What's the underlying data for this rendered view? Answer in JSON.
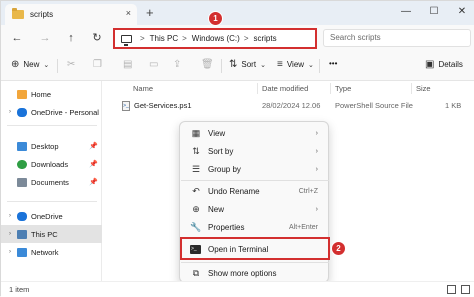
{
  "tab": {
    "title": "scripts",
    "close": "×"
  },
  "new_tab": "+",
  "window_controls": {
    "minimize": "—",
    "maximize": "☐",
    "close": "✕"
  },
  "nav": {
    "back": "←",
    "forward": "→",
    "up": "↑",
    "refresh": "↻"
  },
  "address": {
    "crumbs": [
      "This PC",
      "Windows (C:)",
      "scripts"
    ],
    "separator": ">"
  },
  "search": {
    "placeholder": "Search scripts"
  },
  "callouts": {
    "one": "1",
    "two": "2"
  },
  "commands": {
    "new": "New",
    "sort": "Sort",
    "view": "View",
    "more": "•••",
    "details": "Details"
  },
  "sidebar": {
    "home": "Home",
    "onedrive_personal": "OneDrive - Personal",
    "desktop": "Desktop",
    "downloads": "Downloads",
    "documents": "Documents",
    "onedrive": "OneDrive",
    "this_pc": "This PC",
    "network": "Network"
  },
  "columns": {
    "name": "Name",
    "date": "Date modified",
    "type": "Type",
    "size": "Size"
  },
  "file": {
    "name": "Get-Services.ps1",
    "date": "28/02/2024 12.06",
    "type": "PowerShell Source File",
    "size": "1 KB"
  },
  "context_menu": {
    "view": "View",
    "sort_by": "Sort by",
    "group_by": "Group by",
    "undo_rename": "Undo Rename",
    "undo_shortcut": "Ctrl+Z",
    "new": "New",
    "properties": "Properties",
    "properties_shortcut": "Alt+Enter",
    "open_terminal": "Open in Terminal",
    "show_more": "Show more options"
  },
  "status": {
    "count": "1 item"
  },
  "colors": {
    "accent_red": "#d32f2f",
    "folder": "#e9b84a"
  }
}
